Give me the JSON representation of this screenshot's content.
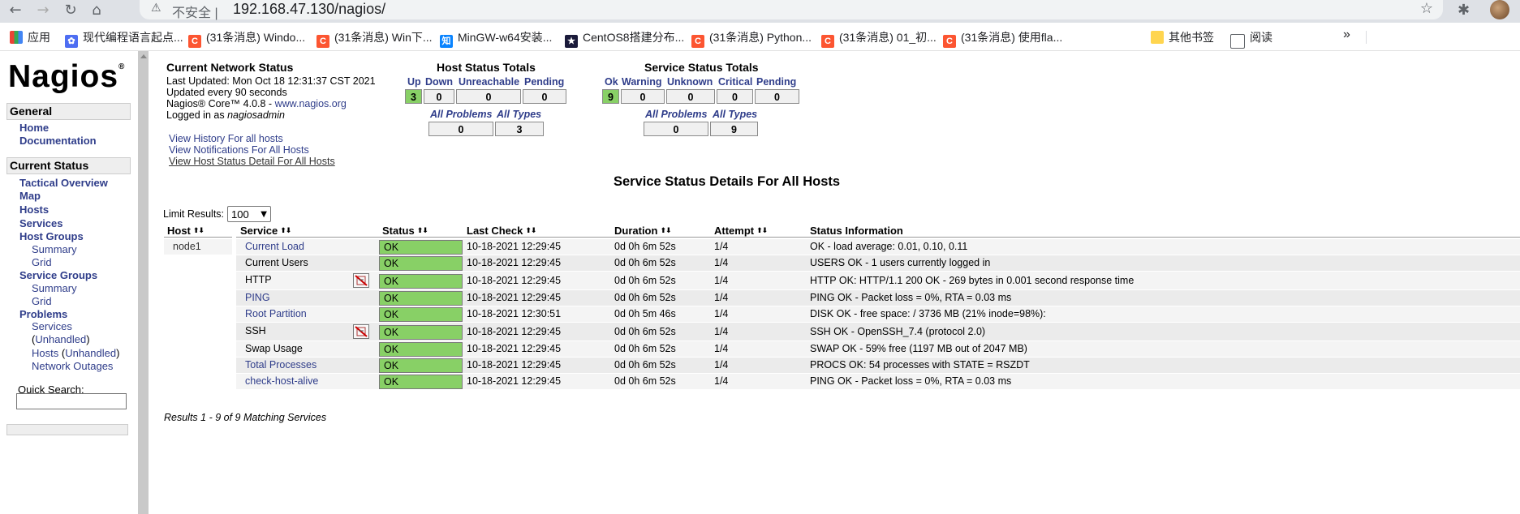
{
  "browser": {
    "insecure_label": "不安全",
    "url": "192.168.47.130/nagios/",
    "bookmarks": [
      "应用",
      "现代编程语言起点...",
      "(31条消息) Windo...",
      "(31条消息) Win下...",
      "MinGW-w64安装...",
      "CentOS8搭建分布...",
      "(31条消息) Python...",
      "(31条消息) 01_初...",
      "(31条消息) 使用fla..."
    ],
    "more": "»",
    "other_bookmarks": "其他书签",
    "reading_list": "阅读"
  },
  "sidebar": {
    "logo": "Nagios",
    "general_header": "General",
    "general_items": [
      "Home",
      "Documentation"
    ],
    "current_status_header": "Current Status",
    "status_items": [
      "Tactical Overview",
      "Map",
      "Hosts",
      "Services",
      "Host Groups"
    ],
    "host_groups_sub": [
      "Summary",
      "Grid"
    ],
    "service_groups": "Service Groups",
    "service_groups_sub": [
      "Summary",
      "Grid"
    ],
    "problems": "Problems",
    "problems_services": "Services",
    "problems_unhandled": "Unhandled",
    "problems_hosts": "Hosts",
    "network_outages": "Network Outages",
    "quick_search_label": "Quick Search:"
  },
  "network_status": {
    "title": "Current Network Status",
    "last_updated": "Last Updated: Mon Oct 18 12:31:37 CST 2021",
    "update_interval": "Updated every 90 seconds",
    "core_prefix": "Nagios® Core™ 4.0.8 - ",
    "core_link": "www.nagios.org",
    "logged_prefix": "Logged in as ",
    "logged_user": "nagiosadmin",
    "links": [
      "View History For all hosts",
      "View Notifications For All Hosts",
      "View Host Status Detail For All Hosts"
    ]
  },
  "host_totals": {
    "title": "Host Status Totals",
    "headers": [
      "Up",
      "Down",
      "Unreachable",
      "Pending"
    ],
    "values": [
      "3",
      "0",
      "0",
      "0"
    ],
    "sum_headers": [
      "All Problems",
      "All Types"
    ],
    "sum_values": [
      "0",
      "3"
    ]
  },
  "service_totals": {
    "title": "Service Status Totals",
    "headers": [
      "Ok",
      "Warning",
      "Unknown",
      "Critical",
      "Pending"
    ],
    "values": [
      "9",
      "0",
      "0",
      "0",
      "0"
    ],
    "sum_headers": [
      "All Problems",
      "All Types"
    ],
    "sum_values": [
      "0",
      "9"
    ]
  },
  "details": {
    "title": "Service Status Details For All Hosts",
    "limit_label": "Limit Results:",
    "limit_value": "100",
    "columns": [
      "Host",
      "Service",
      "Status",
      "Last Check",
      "Duration",
      "Attempt",
      "Status Information"
    ],
    "host": "node1",
    "rows": [
      {
        "service": "Current Load",
        "status": "OK",
        "last_check": "10-18-2021 12:29:45",
        "duration": "0d 0h 6m 52s",
        "attempt": "1/4",
        "info": "OK - load average: 0.01, 0.10, 0.11"
      },
      {
        "service": "Current Users",
        "status": "OK",
        "last_check": "10-18-2021 12:29:45",
        "duration": "0d 0h 6m 52s",
        "attempt": "1/4",
        "info": "USERS OK - 1 users currently logged in"
      },
      {
        "service": "HTTP",
        "status": "OK",
        "last_check": "10-18-2021 12:29:45",
        "duration": "0d 0h 6m 52s",
        "attempt": "1/4",
        "info": "HTTP OK: HTTP/1.1 200 OK - 269 bytes in 0.001 second response time"
      },
      {
        "service": "PING",
        "status": "OK",
        "last_check": "10-18-2021 12:29:45",
        "duration": "0d 0h 6m 52s",
        "attempt": "1/4",
        "info": "PING OK - Packet loss = 0%, RTA = 0.03 ms"
      },
      {
        "service": "Root Partition",
        "status": "OK",
        "last_check": "10-18-2021 12:30:51",
        "duration": "0d 0h 5m 46s",
        "attempt": "1/4",
        "info": "DISK OK - free space: / 3736 MB (21% inode=98%):"
      },
      {
        "service": "SSH",
        "status": "OK",
        "last_check": "10-18-2021 12:29:45",
        "duration": "0d 0h 6m 52s",
        "attempt": "1/4",
        "info": "SSH OK - OpenSSH_7.4 (protocol 2.0)"
      },
      {
        "service": "Swap Usage",
        "status": "OK",
        "last_check": "10-18-2021 12:29:45",
        "duration": "0d 0h 6m 52s",
        "attempt": "1/4",
        "info": "SWAP OK - 59% free (1197 MB out of 2047 MB)"
      },
      {
        "service": "Total Processes",
        "status": "OK",
        "last_check": "10-18-2021 12:29:45",
        "duration": "0d 0h 6m 52s",
        "attempt": "1/4",
        "info": "PROCS OK: 54 processes with STATE = RSZDT"
      },
      {
        "service": "check-host-alive",
        "status": "OK",
        "last_check": "10-18-2021 12:29:45",
        "duration": "0d 0h 6m 52s",
        "attempt": "1/4",
        "info": "PING OK - Packet loss = 0%, RTA = 0.03 ms"
      }
    ],
    "results": "Results 1 - 9 of 9 Matching Services"
  },
  "colors": {
    "ok_green": "#88d066",
    "link_blue": "#2f3d8a"
  }
}
